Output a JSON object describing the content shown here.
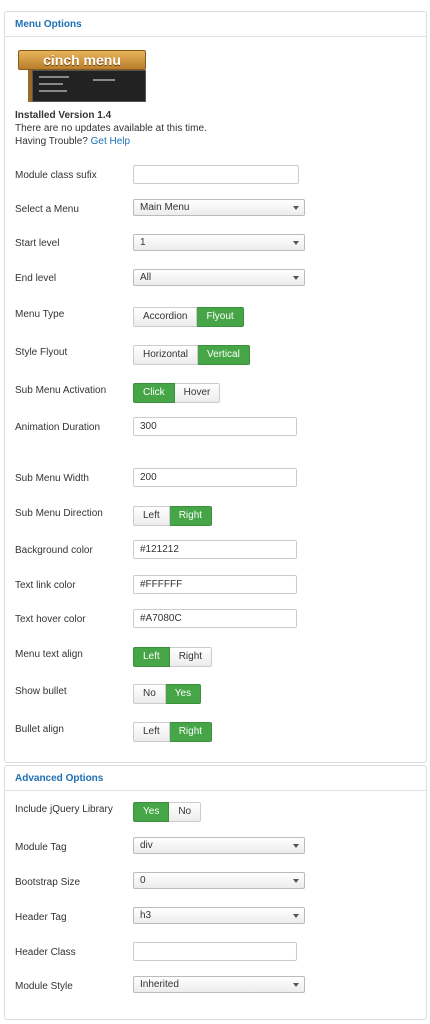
{
  "menu_panel": {
    "title": "Menu Options",
    "logo_text": "cinch menu",
    "installed": "Installed Version 1.4",
    "updates": "There are no updates available at this time.",
    "trouble": "Having Trouble?",
    "help_link": "Get Help",
    "fields": {
      "module_class": {
        "label": "Module class sufix",
        "value": ""
      },
      "select_menu": {
        "label": "Select a Menu",
        "value": "Main Menu"
      },
      "start_level": {
        "label": "Start level",
        "value": "1"
      },
      "end_level": {
        "label": "End level",
        "value": "All"
      },
      "menu_type": {
        "label": "Menu Type",
        "options": [
          "Accordion",
          "Flyout"
        ],
        "selected": "Flyout"
      },
      "style_flyout": {
        "label": "Style Flyout",
        "options": [
          "Horizontal",
          "Vertical"
        ],
        "selected": "Vertical"
      },
      "sub_activation": {
        "label": "Sub Menu Activation",
        "options": [
          "Click",
          "Hover"
        ],
        "selected": "Click"
      },
      "anim_duration": {
        "label": "Animation Duration",
        "value": "300"
      },
      "sub_width": {
        "label": "Sub Menu Width",
        "value": "200"
      },
      "sub_direction": {
        "label": "Sub Menu Direction",
        "options": [
          "Left",
          "Right"
        ],
        "selected": "Right"
      },
      "bg_color": {
        "label": "Background color",
        "value": "#121212"
      },
      "link_color": {
        "label": "Text link color",
        "value": "#FFFFFF"
      },
      "hover_color": {
        "label": "Text hover color",
        "value": "#A7080C"
      },
      "text_align": {
        "label": "Menu text align",
        "options": [
          "Left",
          "Right"
        ],
        "selected": "Left"
      },
      "show_bullet": {
        "label": "Show bullet",
        "options": [
          "No",
          "Yes"
        ],
        "selected": "Yes"
      },
      "bullet_align": {
        "label": "Bullet align",
        "options": [
          "Left",
          "Right"
        ],
        "selected": "Right"
      }
    }
  },
  "advanced_panel": {
    "title": "Advanced Options",
    "fields": {
      "include_jquery": {
        "label": "Include jQuery Library",
        "options": [
          "Yes",
          "No"
        ],
        "selected": "Yes"
      },
      "module_tag": {
        "label": "Module Tag",
        "value": "div"
      },
      "bootstrap_size": {
        "label": "Bootstrap Size",
        "value": "0"
      },
      "header_tag": {
        "label": "Header Tag",
        "value": "h3"
      },
      "header_class": {
        "label": "Header Class",
        "value": ""
      },
      "module_style": {
        "label": "Module Style",
        "value": "Inherited"
      }
    }
  },
  "colors": {
    "accent": "#46a546",
    "title_blue": "#1f6fb5"
  }
}
